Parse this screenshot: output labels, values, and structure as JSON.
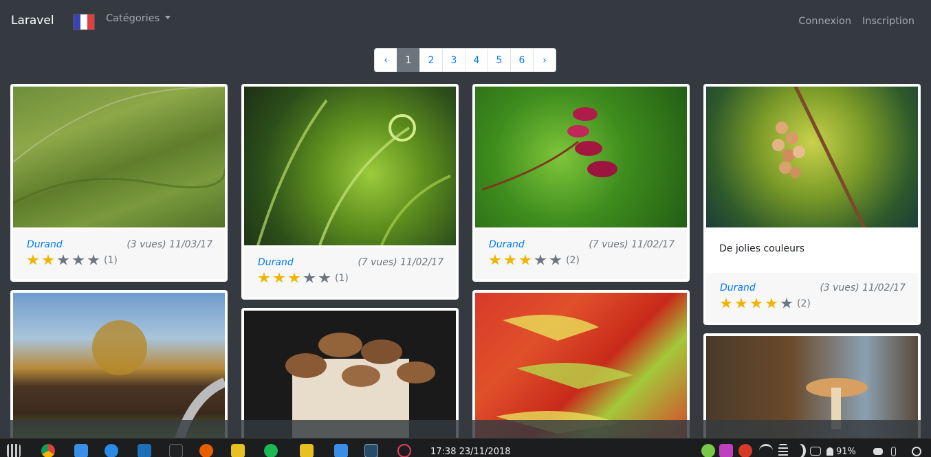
{
  "navbar": {
    "brand": "Laravel",
    "categories_label": "Catégories",
    "login": "Connexion",
    "register": "Inscription",
    "flag_colors": [
      "#3a43b4",
      "#ffffff",
      "#e04040"
    ]
  },
  "pagination": {
    "prev": "‹",
    "pages": [
      "1",
      "2",
      "3",
      "4",
      "5",
      "6"
    ],
    "next": "›",
    "active": "1"
  },
  "cards": [
    {
      "author": "Durand",
      "meta": "(3 vues) 11/03/17",
      "rating": 2,
      "count": "(1)",
      "image": "green hills landscape"
    },
    {
      "author": "Durand",
      "meta": "(7 vues) 11/02/17",
      "rating": 3,
      "count": "(1)",
      "image": "fern fronds close-up"
    },
    {
      "author": "Durand",
      "meta": "(7 vues) 11/02/17",
      "rating": 3,
      "count": "(2)",
      "image": "pink flower buds"
    },
    {
      "author": "Durand",
      "meta": "(3 vues) 11/02/17",
      "rating": 4,
      "count": "(2)",
      "description": "De jolies couleurs",
      "image": "grapes on the vine"
    },
    {
      "image": "autumn field with road"
    },
    {
      "image": "mushrooms cluster"
    },
    {
      "image": "red heliconia flower"
    },
    {
      "image": "mushroom in forest"
    }
  ],
  "taskbar": {
    "clock": "17:38 23/11/2018",
    "battery": "91%"
  }
}
